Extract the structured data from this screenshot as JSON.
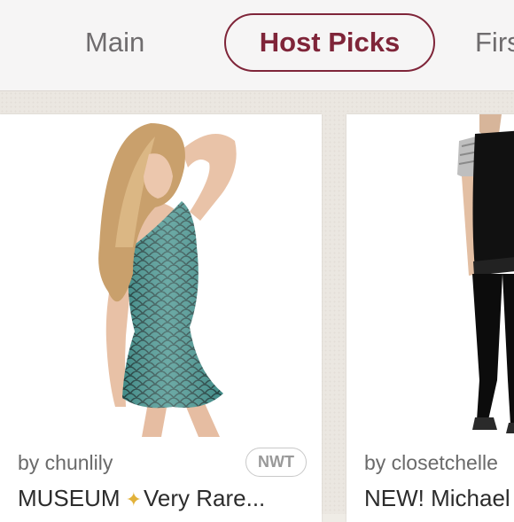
{
  "tabs": [
    {
      "label": "Main",
      "active": false
    },
    {
      "label": "Host Picks",
      "active": true
    },
    {
      "label": "Firs",
      "active": false
    }
  ],
  "colors": {
    "accent": "#7f2539",
    "dress": "#3f8a86",
    "background": "#ebe7e1"
  },
  "listings": [
    {
      "seller_text": "by chunlily",
      "condition_badge": "NWT",
      "title_prefix": "MUSEUM",
      "title_emoji_icon": "dizzy-sparkle-icon",
      "title_suffix": "Very Rare...",
      "image_icon": "mermaid-scale-dress-photo"
    },
    {
      "seller_text": "by closetchelle",
      "title": "NEW! Michael",
      "image_icon": "black-jumpsuit-photo"
    }
  ]
}
